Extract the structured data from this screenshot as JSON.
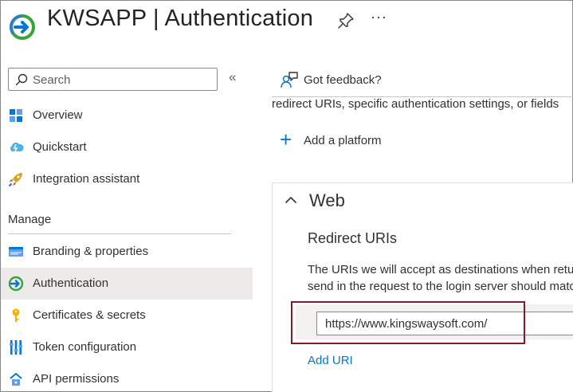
{
  "header": {
    "app_name": "KWSAPP",
    "separator": "|",
    "page": "Authentication",
    "icons": [
      "app-registration-icon",
      "pin-icon",
      "more-icon"
    ],
    "more": "···"
  },
  "sidebar": {
    "search_placeholder": "Search",
    "collapse": "«",
    "items": [
      {
        "label": "Overview",
        "icon": "overview-icon"
      },
      {
        "label": "Quickstart",
        "icon": "quickstart-icon"
      },
      {
        "label": "Integration assistant",
        "icon": "integration-icon"
      }
    ],
    "section_label": "Manage",
    "manage_items": [
      {
        "label": "Branding & properties",
        "icon": "branding-icon"
      },
      {
        "label": "Authentication",
        "icon": "authentication-icon",
        "active": true
      },
      {
        "label": "Certificates & secrets",
        "icon": "key-icon"
      },
      {
        "label": "Token configuration",
        "icon": "token-icon"
      },
      {
        "label": "API permissions",
        "icon": "api-icon"
      }
    ]
  },
  "main": {
    "feedback": "Got feedback?",
    "intro_text": "redirect URIs, specific authentication settings, or fields",
    "add_platform": "Add a platform",
    "web": {
      "title": "Web",
      "redirect_title": "Redirect URIs",
      "description_line1": "The URIs we will accept as destinations when returning",
      "description_line2": "send in the request to the login server should match",
      "uri_value": "https://www.kingswaysoft.com/",
      "add_uri": "Add URI"
    }
  },
  "colors": {
    "accent": "#0078d4",
    "highlight_border": "#7b1e2c",
    "active_nav_bg": "#edebe9",
    "app_icon_green": "#3aa33a"
  }
}
